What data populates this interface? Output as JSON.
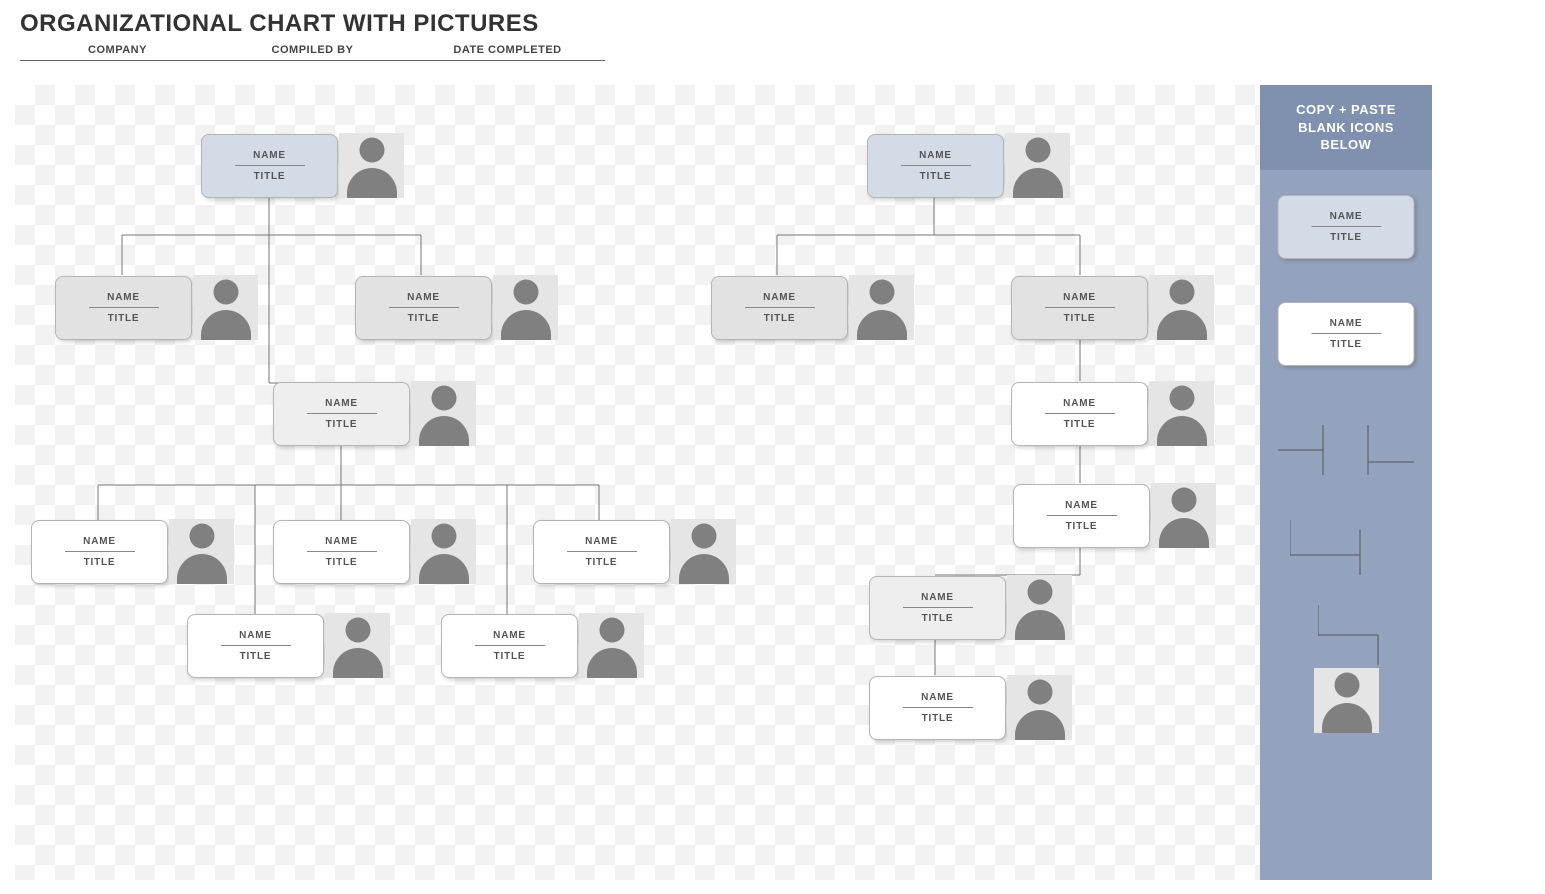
{
  "header": {
    "title": "ORGANIZATIONAL CHART WITH PICTURES",
    "columns": [
      "COMPANY",
      "COMPILED BY",
      "DATE COMPLETED"
    ]
  },
  "sidebar": {
    "heading_l1": "COPY + PASTE",
    "heading_l2": "BLANK ICONS",
    "heading_l3": "BELOW",
    "sample_blue": {
      "name": "NAME",
      "title": "TITLE"
    },
    "sample_white": {
      "name": "NAME",
      "title": "TITLE"
    }
  },
  "placeholder": {
    "name": "NAME",
    "title": "TITLE"
  },
  "tree_left": {
    "root": {
      "name": "NAME",
      "title": "TITLE"
    },
    "l1a": {
      "name": "NAME",
      "title": "TITLE"
    },
    "l1b": {
      "name": "NAME",
      "title": "TITLE"
    },
    "l2": {
      "name": "NAME",
      "title": "TITLE"
    },
    "l3a": {
      "name": "NAME",
      "title": "TITLE"
    },
    "l3b": {
      "name": "NAME",
      "title": "TITLE"
    },
    "l3c": {
      "name": "NAME",
      "title": "TITLE"
    },
    "l4a": {
      "name": "NAME",
      "title": "TITLE"
    },
    "l4b": {
      "name": "NAME",
      "title": "TITLE"
    }
  },
  "tree_right": {
    "root": {
      "name": "NAME",
      "title": "TITLE"
    },
    "l1a": {
      "name": "NAME",
      "title": "TITLE"
    },
    "l1b": {
      "name": "NAME",
      "title": "TITLE"
    },
    "l2": {
      "name": "NAME",
      "title": "TITLE"
    },
    "l3": {
      "name": "NAME",
      "title": "TITLE"
    },
    "l4": {
      "name": "NAME",
      "title": "TITLE"
    },
    "l5": {
      "name": "NAME",
      "title": "TITLE"
    }
  }
}
